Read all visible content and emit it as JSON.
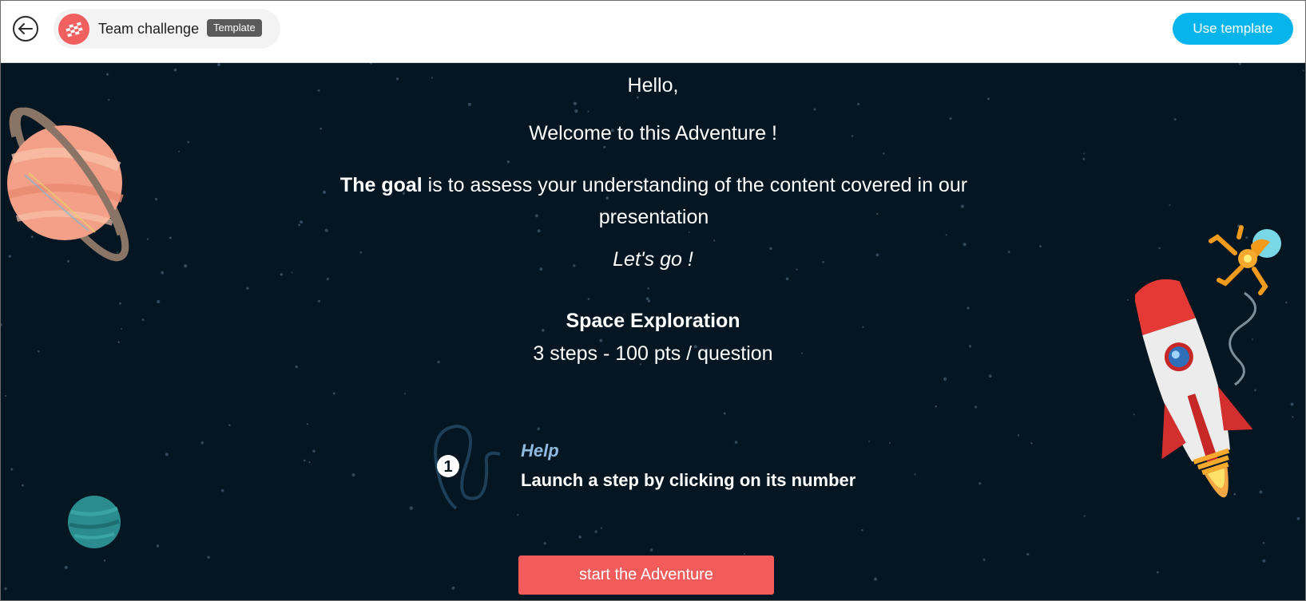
{
  "header": {
    "app_title": "Team challenge",
    "badge": "Template",
    "use_template_label": "Use template"
  },
  "content": {
    "hello": "Hello,",
    "welcome": "Welcome to this Adventure !",
    "goal_bold": "The goal",
    "goal_rest": " is to assess your understanding of the content covered in our presentation",
    "lets_go": "Let's go !",
    "adventure_title": "Space Exploration",
    "adventure_info": "3 steps - 100 pts / question"
  },
  "help": {
    "label": "Help",
    "text": "Launch a step by clicking on its number",
    "step_number": "1"
  },
  "start_button_label": "start the Adventure",
  "colors": {
    "accent": "#08b4ec",
    "start_button": "#f45c5c",
    "background": "#031621",
    "help_label": "#8fb9de"
  },
  "icons": {
    "back": "back-arrow-icon",
    "logo": "checkered-flag-icon"
  }
}
